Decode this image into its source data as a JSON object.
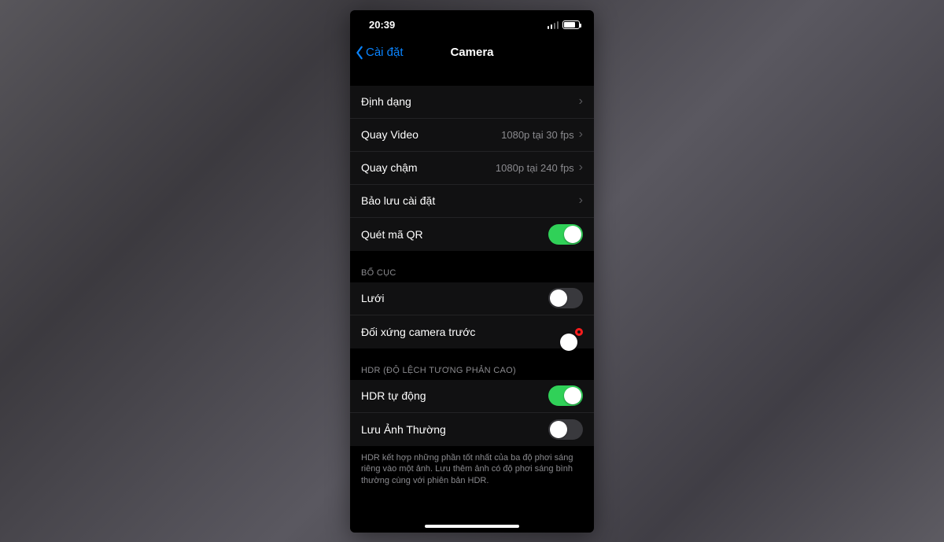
{
  "status": {
    "time": "20:39"
  },
  "nav": {
    "back": "Cài đặt",
    "title": "Camera"
  },
  "group1": {
    "format": "Định dạng",
    "record_video": {
      "label": "Quay Video",
      "value": "1080p tại 30 fps"
    },
    "slow_mo": {
      "label": "Quay chậm",
      "value": "1080p tại 240 fps"
    },
    "preserve": "Bảo lưu cài đặt",
    "qr": "Quét mã QR"
  },
  "layout": {
    "header": "BỐ CỤC",
    "grid": "Lưới",
    "mirror": "Đối xứng camera trước"
  },
  "hdr": {
    "header": "HDR (ĐỘ LỆCH TƯƠNG PHẢN CAO)",
    "auto": "HDR tự động",
    "keep": "Lưu Ảnh Thường",
    "footer": "HDR kết hợp những phần tốt nhất của ba độ phơi sáng riêng vào một ảnh. Lưu thêm ảnh có độ phơi sáng bình thường cùng với phiên bản HDR."
  },
  "toggles": {
    "qr": true,
    "grid": false,
    "mirror": true,
    "auto_hdr": true,
    "keep_normal": false
  }
}
